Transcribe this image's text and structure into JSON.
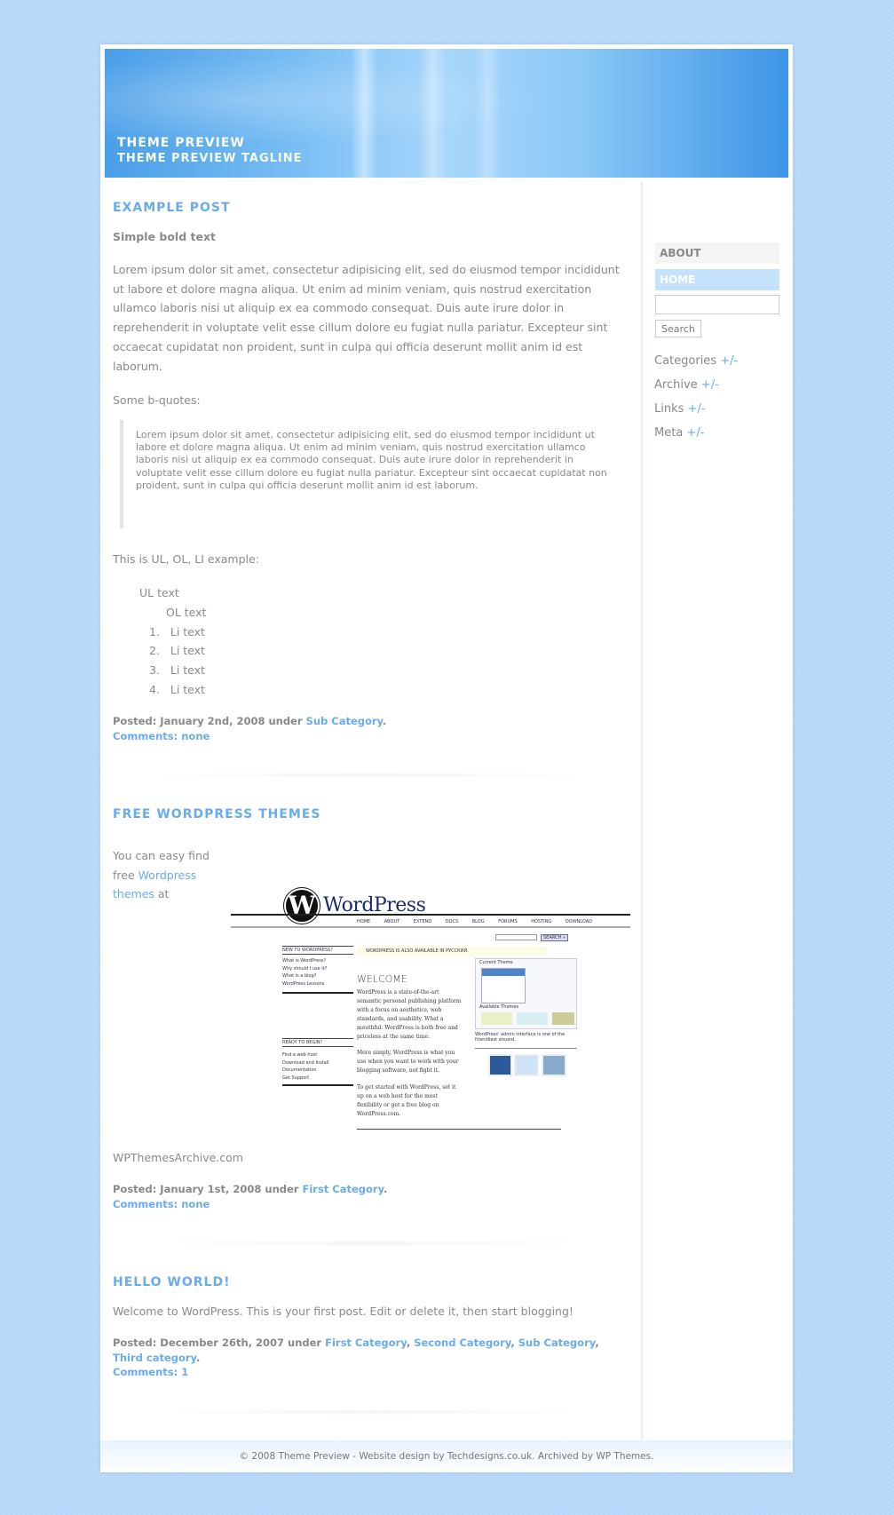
{
  "header": {
    "title": "THEME PREVIEW",
    "tagline": "THEME PREVIEW TAGLINE"
  },
  "posts": [
    {
      "title": "EXAMPLE POST",
      "bold": "Simple bold text",
      "para": "Lorem ipsum dolor sit amet, consectetur adipisicing elit, sed do eiusmod tempor incididunt ut labore et dolore magna aliqua. Ut enim ad minim veniam, quis nostrud exercitation ullamco laboris nisi ut aliquip ex ea commodo consequat. Duis aute irure dolor in reprehenderit in voluptate velit esse cillum dolore eu fugiat nulla pariatur. Excepteur sint occaecat cupidatat non proident, sunt in culpa qui officia deserunt mollit anim id est laborum.",
      "bq_intro": "Some b-quotes:",
      "quote": "Lorem ipsum dolor sit amet, consectetur adipisicing elit, sed do eiusmod tempor incididunt ut labore et dolore magna aliqua. Ut enim ad minim veniam, quis nostrud exercitation ullamco laboris nisi ut aliquip ex ea commodo consequat. Duis aute irure dolor in reprehenderit in voluptate velit esse cillum dolore eu fugiat nulla pariatur. Excepteur sint occaecat cupidatat non proident, sunt in culpa qui officia deserunt mollit anim id est laborum.",
      "list_intro": "This is UL, OL, LI example:",
      "ul": "UL text",
      "ol": "OL text",
      "li": [
        "Li text",
        "Li text",
        "Li text",
        "Li text"
      ],
      "posted": "Posted: January 2nd, 2008 under ",
      "cats": [
        "Sub Category"
      ],
      "comments": "Comments: none"
    },
    {
      "title": "FREE WORDPRESS THEMES",
      "text1": "You can easy find free ",
      "link": "Wordpress themes",
      "text2": " at",
      "source": "WPThemesArchive.com",
      "posted": "Posted: January 1st, 2008 under ",
      "cats": [
        "First Category"
      ],
      "comments": "Comments: none"
    },
    {
      "title": "HELLO WORLD!",
      "text": "Welcome to WordPress. This is your first post. Edit or delete it, then start blogging!",
      "posted": "Posted: December 26th, 2007 under ",
      "cats": [
        "First Category",
        "Second Category",
        "Sub Category",
        "Third category"
      ],
      "comments": "Comments: 1"
    }
  ],
  "wp_image": {
    "logo": "WordPress",
    "nav": [
      "HOME",
      "ABOUT",
      "EXTEND",
      "DOCS",
      "BLOG",
      "FORUMS",
      "HOSTING",
      "DOWNLOAD"
    ],
    "search": "SEARCH »",
    "notice": "WORDPRESS IS ALSO AVAILABLE IN РУССКИЙ.",
    "welcome": "WELCOME",
    "p1": "WordPress is a state-of-the-art semantic personal publishing platform with a focus on aesthetics, web standards, and usability. What a mouthful. WordPress is both free and priceless at the same time.",
    "p2": "More simply, WordPress is what you use when you want to work with your blogging software, not fight it.",
    "p3": "To get started with WordPress, set it up on a web host for the most flexibility or get a free blog on WordPress.com.",
    "new_head": "NEW TO WORDPRESS?",
    "new_items": [
      "What is WordPress?",
      "Why should I use it?",
      "What is a blog?",
      "WordPress Lessons"
    ],
    "ready_head": "READY TO BEGIN?",
    "ready_items": [
      "Find a web host",
      "Download and Install",
      "Documentation",
      "Get Support"
    ],
    "current_theme": "Current Theme",
    "available": "Available Themes",
    "caption": "WordPress' admin interface is one of the friendliest around."
  },
  "sidebar": {
    "pages": [
      "ABOUT",
      "HOME"
    ],
    "search_value": "",
    "search_button": "Search",
    "widgets": [
      "Categories",
      "Archive",
      "Links",
      "Meta"
    ],
    "toggle": "+/-"
  },
  "footer": "© 2008 Theme Preview - Website design by Techdesigns.co.uk. Archived by WP Themes.",
  "colors": {
    "accent": "#6aacea",
    "background": "#bcdcfb",
    "home_active": "#c5e2fd"
  }
}
